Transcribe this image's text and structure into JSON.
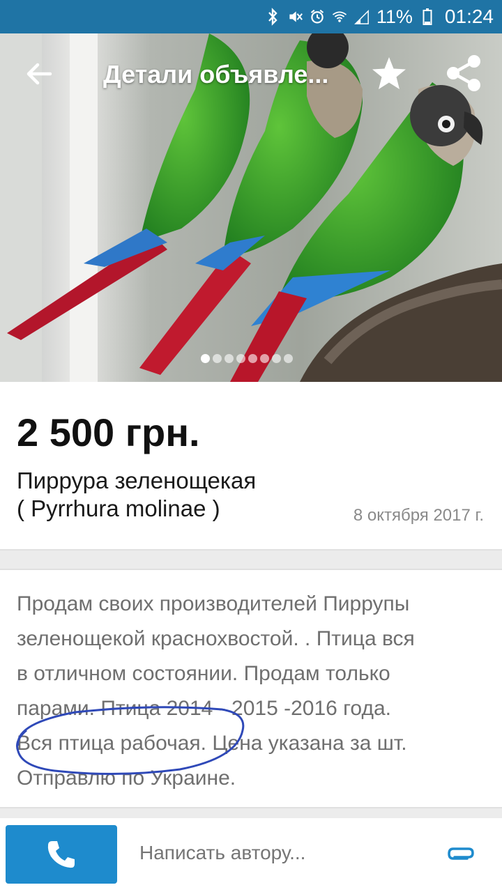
{
  "status_bar": {
    "battery_percent": "11%",
    "time": "01:24",
    "icons": [
      "bluetooth-icon",
      "mute-icon",
      "alarm-icon",
      "wifi-icon",
      "signal-icon",
      "battery-icon"
    ]
  },
  "toolbar": {
    "title": "Детали объявле...",
    "icons": [
      "back-arrow-icon",
      "star-icon",
      "share-icon"
    ]
  },
  "gallery": {
    "image_count": 8,
    "active_index": 0
  },
  "listing": {
    "price": "2 500 грн.",
    "title_line1": "Пиррура зеленощекая",
    "title_line2": "( Pyrrhura molinae )",
    "date": "8 октября 2017 г."
  },
  "description": {
    "lines": [
      "Продам своих производителей Пиррупы",
      "зеленощекой краснохвостой. . Птица вся",
      "в отличном состоянии. Продам только",
      "парами. Птица 2014 - 2015 -2016 года.",
      "Вся птица рабочая. Цена указана за шт.",
      "Отправлю по Украине."
    ]
  },
  "bottom_bar": {
    "message_placeholder": "Написать автору...",
    "icons": [
      "phone-icon",
      "paperclip-icon"
    ]
  },
  "colors": {
    "status_bar": "#1f74a5",
    "call_button": "#1e8bcd",
    "attach_icon": "#1e8bcd",
    "annotation": "#2f49b8"
  }
}
